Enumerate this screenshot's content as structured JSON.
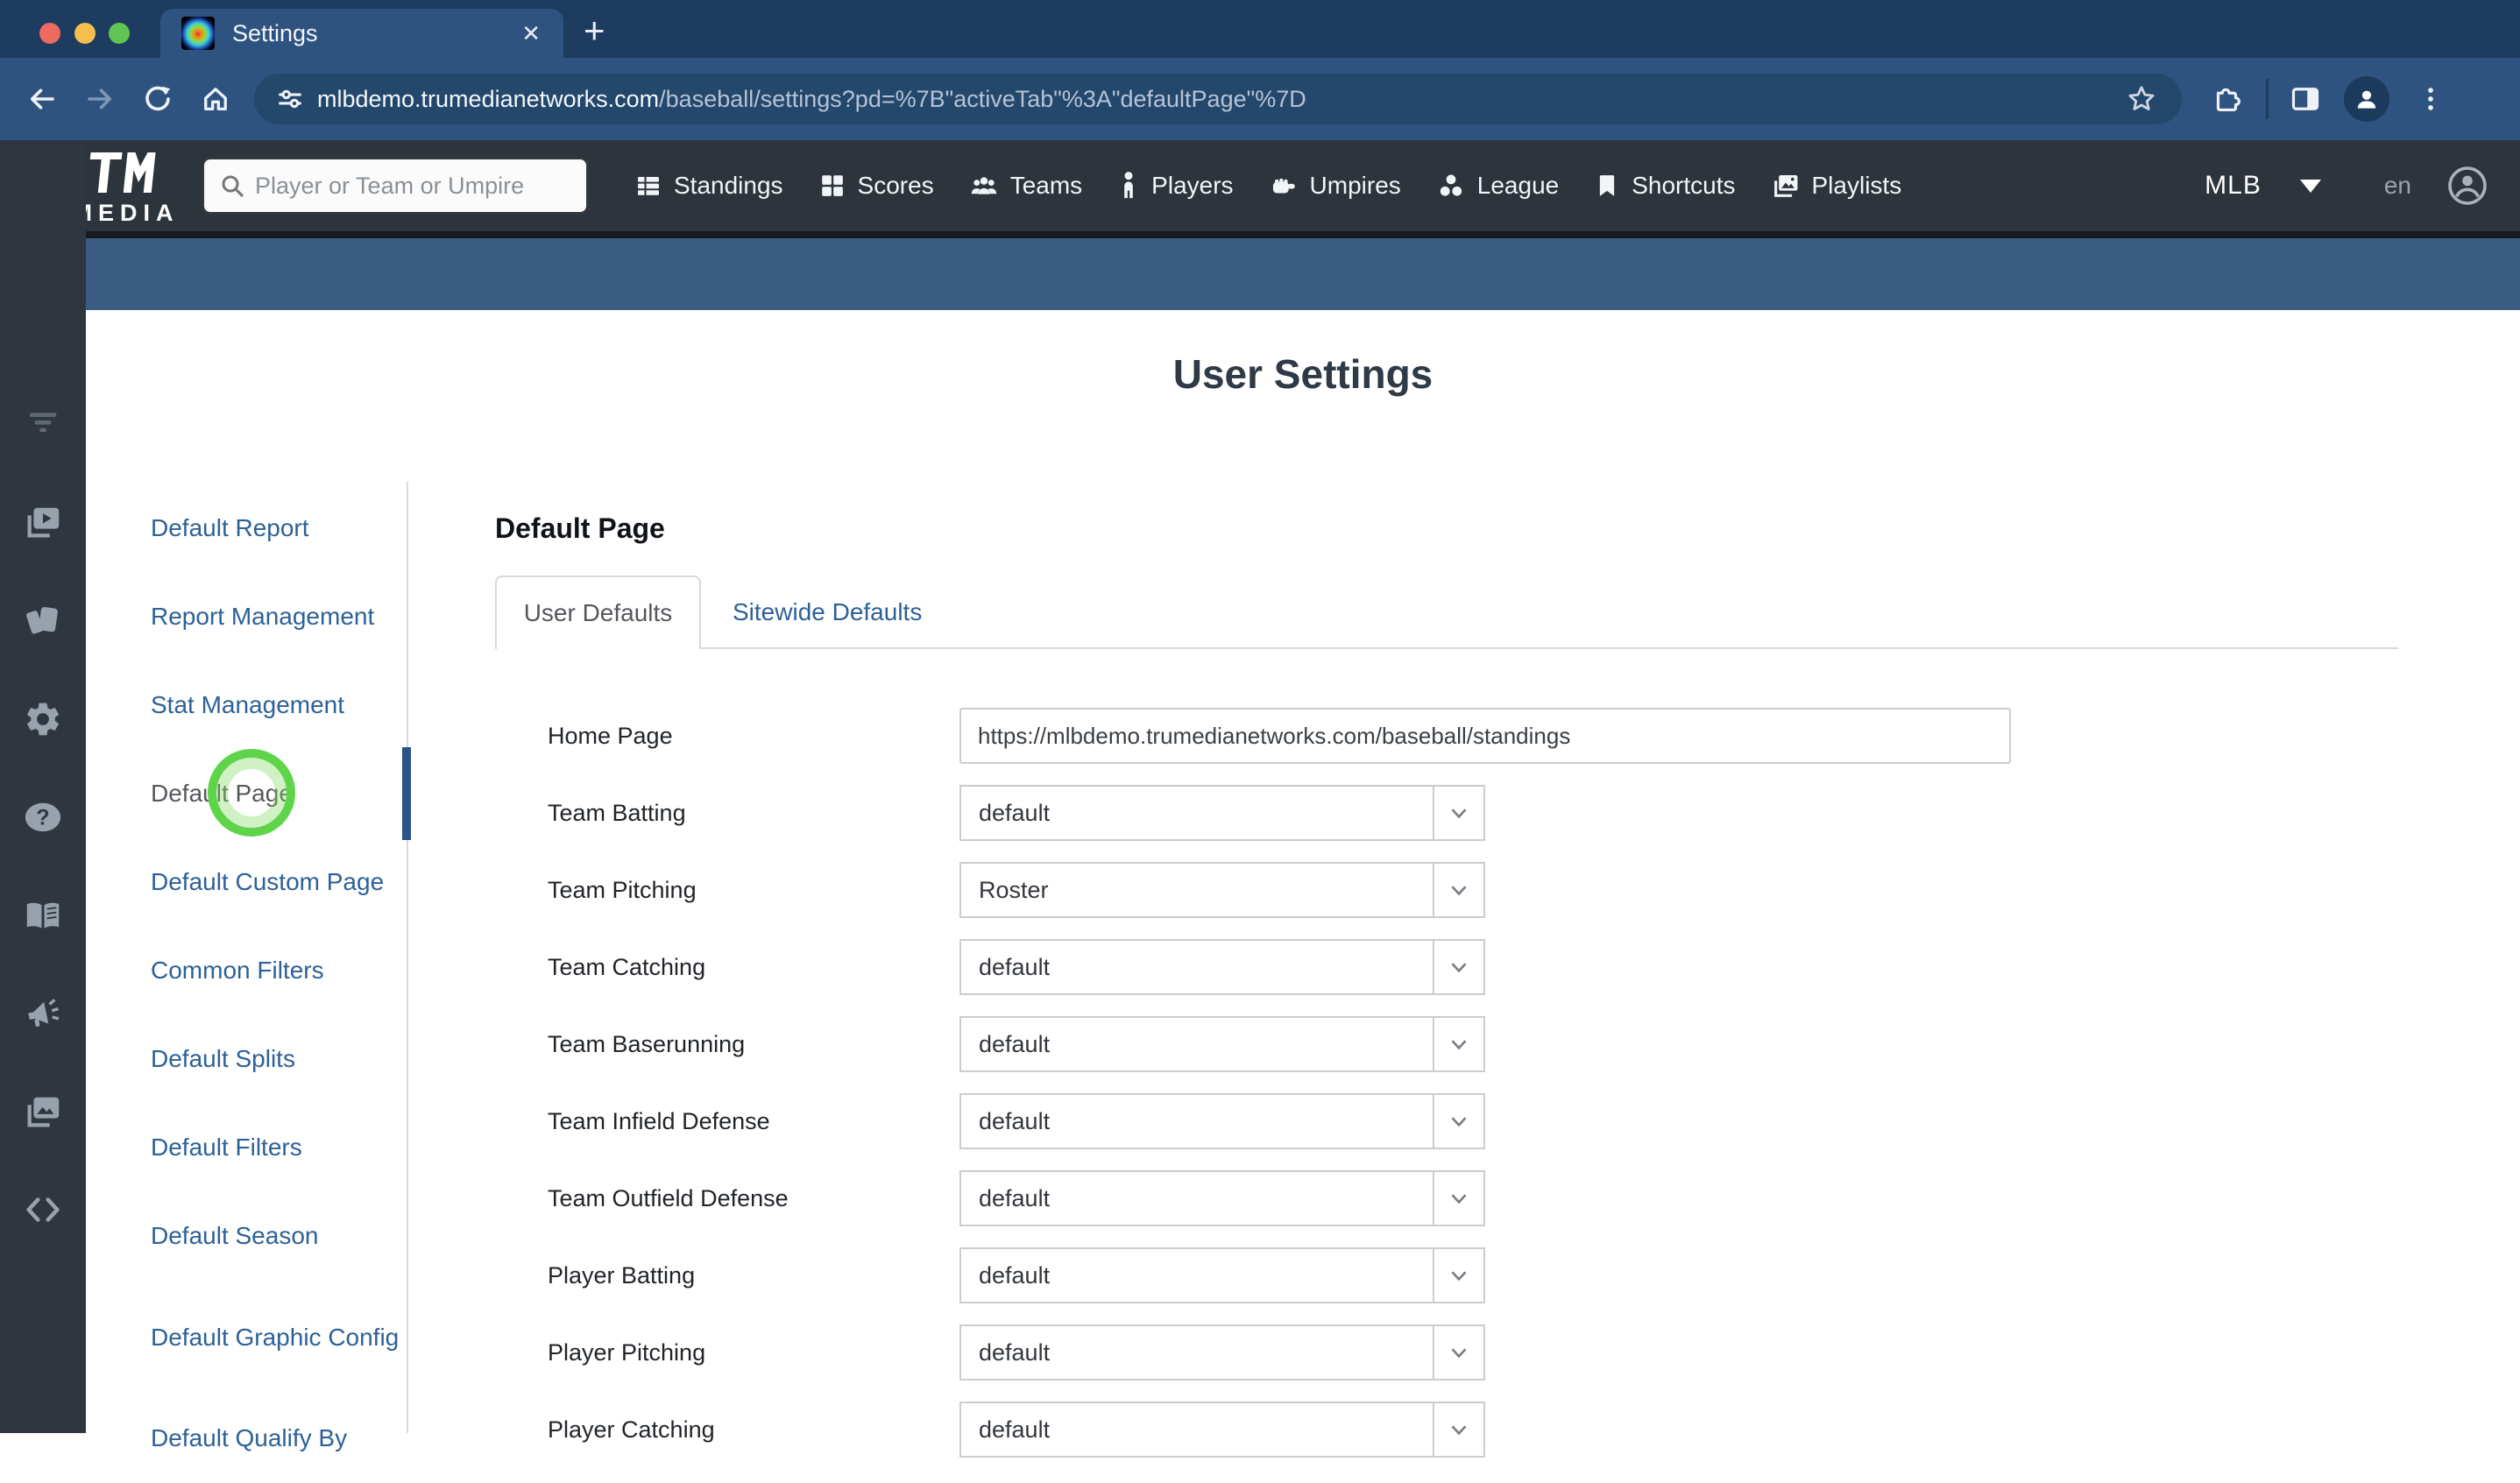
{
  "browser": {
    "tab": {
      "title": "Settings",
      "close_glyph": "✕"
    },
    "new_tab_glyph": "+",
    "url": {
      "host": "mlbdemo.trumedianetworks.com",
      "path": "/baseball/settings?pd=%7B\"activeTab\"%3A\"defaultPage\"%7D"
    }
  },
  "topnav": {
    "brand": "TRUMEDIA",
    "search_placeholder": "Player or Team or Umpire",
    "items": [
      {
        "label": "Standings"
      },
      {
        "label": "Scores"
      },
      {
        "label": "Teams"
      },
      {
        "label": "Players"
      },
      {
        "label": "Umpires"
      },
      {
        "label": "League"
      },
      {
        "label": "Shortcuts"
      },
      {
        "label": "Playlists"
      }
    ],
    "league": "MLB",
    "language": "en"
  },
  "settings_menu": {
    "items": [
      {
        "label": "Default Report"
      },
      {
        "label": "Report Management"
      },
      {
        "label": "Stat Management"
      },
      {
        "label": "Default Page",
        "active": true
      },
      {
        "label": "Default Custom Page"
      },
      {
        "label": "Common Filters"
      },
      {
        "label": "Default Splits"
      },
      {
        "label": "Default Filters"
      },
      {
        "label": "Default Season"
      },
      {
        "label": "Default Graphic Config"
      },
      {
        "label": "Default Qualify By"
      }
    ]
  },
  "main": {
    "page_title": "User Settings",
    "section_title": "Default Page",
    "tabs": [
      {
        "label": "User Defaults",
        "active": true
      },
      {
        "label": "Sitewide Defaults",
        "active": false
      }
    ],
    "fields": [
      {
        "label": "Home Page",
        "type": "text",
        "value": "https://mlbdemo.trumedianetworks.com/baseball/standings"
      },
      {
        "label": "Team Batting",
        "type": "select",
        "value": "default"
      },
      {
        "label": "Team Pitching",
        "type": "select",
        "value": "Roster"
      },
      {
        "label": "Team Catching",
        "type": "select",
        "value": "default"
      },
      {
        "label": "Team Baserunning",
        "type": "select",
        "value": "default"
      },
      {
        "label": "Team Infield Defense",
        "type": "select",
        "value": "default"
      },
      {
        "label": "Team Outfield Defense",
        "type": "select",
        "value": "default"
      },
      {
        "label": "Player Batting",
        "type": "select",
        "value": "default"
      },
      {
        "label": "Player Pitching",
        "type": "select",
        "value": "default"
      },
      {
        "label": "Player Catching",
        "type": "select",
        "value": "default"
      }
    ]
  },
  "colors": {
    "chrome_tabstrip": "#1e3b60",
    "chrome_toolbar": "#2f5381",
    "chrome_urlpill": "#24476c",
    "appnav_dark": "#2e343c",
    "sidebar_dark": "#30363f",
    "blue_strip": "#3a5b82",
    "link_blue": "#2d6197",
    "active_bar_blue": "#2c5586",
    "click_ring_green": "#5fd44a",
    "traffic_red": "#ed6a5e",
    "traffic_yellow": "#f4bf4f",
    "traffic_green": "#61c554"
  }
}
